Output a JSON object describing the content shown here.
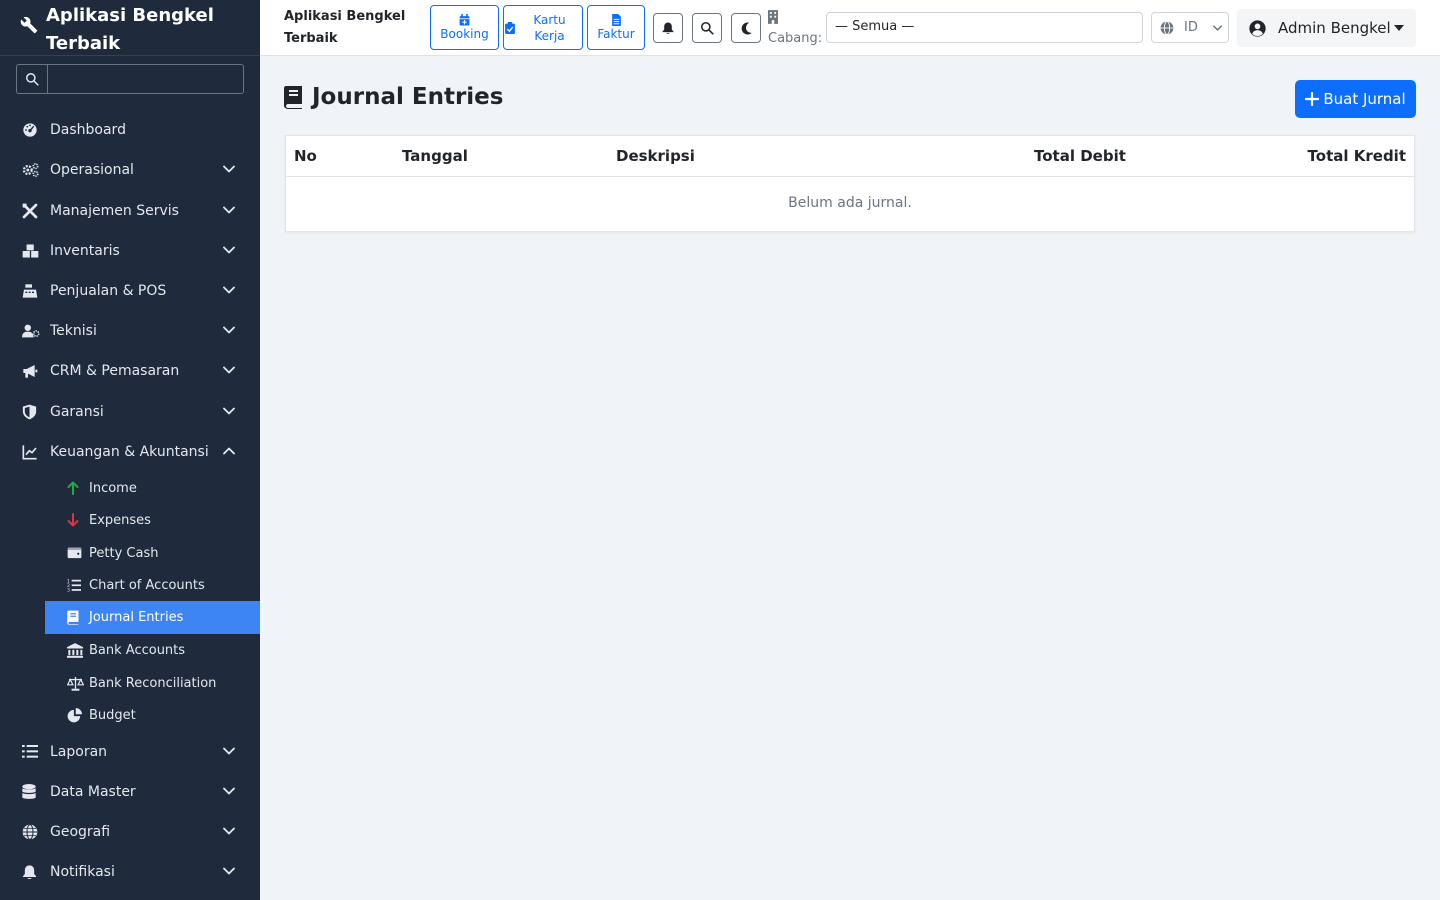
{
  "app": {
    "brand": "Aplikasi Bengkel Terbaik",
    "topbar_title": "Aplikasi Bengkel Terbaik"
  },
  "sidebar": {
    "search": {
      "value": "",
      "placeholder": ""
    },
    "items": [
      {
        "label": "Dashboard",
        "icon": "gauge-icon",
        "expandable": false
      },
      {
        "label": "Operasional",
        "icon": "cogs-icon",
        "expandable": true
      },
      {
        "label": "Manajemen Servis",
        "icon": "tools-icon",
        "expandable": true
      },
      {
        "label": "Inventaris",
        "icon": "boxes-icon",
        "expandable": true
      },
      {
        "label": "Penjualan & POS",
        "icon": "cash-register-icon",
        "expandable": true
      },
      {
        "label": "Teknisi",
        "icon": "user-gear-icon",
        "expandable": true
      },
      {
        "label": "CRM & Pemasaran",
        "icon": "megaphone-icon",
        "expandable": true
      },
      {
        "label": "Garansi",
        "icon": "shield-icon",
        "expandable": true
      },
      {
        "label": "Keuangan & Akuntansi",
        "icon": "chart-line-icon",
        "expandable": true,
        "expanded": true
      },
      {
        "label": "Laporan",
        "icon": "list-icon",
        "expandable": true
      },
      {
        "label": "Data Master",
        "icon": "database-icon",
        "expandable": true
      },
      {
        "label": "Geografi",
        "icon": "globe-icon",
        "expandable": true
      },
      {
        "label": "Notifikasi",
        "icon": "bell-icon",
        "expandable": true
      }
    ],
    "finance_subitems": [
      {
        "label": "Income",
        "icon": "arrow-up-icon",
        "color": "#28a745"
      },
      {
        "label": "Expenses",
        "icon": "arrow-down-icon",
        "color": "#dc3545"
      },
      {
        "label": "Petty Cash",
        "icon": "wallet-icon"
      },
      {
        "label": "Chart of Accounts",
        "icon": "list-ol-icon"
      },
      {
        "label": "Journal Entries",
        "icon": "book-icon",
        "active": true
      },
      {
        "label": "Bank Accounts",
        "icon": "bank-icon"
      },
      {
        "label": "Bank Reconciliation",
        "icon": "scale-icon"
      },
      {
        "label": "Budget",
        "icon": "pie-chart-icon"
      }
    ]
  },
  "topbar": {
    "quick_buttons": [
      {
        "label": "Booking",
        "icon": "calendar-plus-icon"
      },
      {
        "label": "Kartu Kerja",
        "icon": "clipboard-check-icon"
      },
      {
        "label": "Faktur",
        "icon": "invoice-icon"
      }
    ],
    "branch_label": "Cabang:",
    "branch_value": "— Semua —",
    "language_value": "ID",
    "user_name": "Admin Bengkel"
  },
  "page": {
    "title": "Journal Entries",
    "create_button": "Buat Jurnal"
  },
  "table": {
    "columns": [
      "No",
      "Tanggal",
      "Deskripsi",
      "Total Debit",
      "Total Kredit"
    ],
    "empty_message": "Belum ada jurnal."
  },
  "colors": {
    "sidebar_bg": "#1f2a3c",
    "active_item": "#3d85f5",
    "primary": "#0d6efd",
    "page_bg": "#f0f4f9"
  }
}
